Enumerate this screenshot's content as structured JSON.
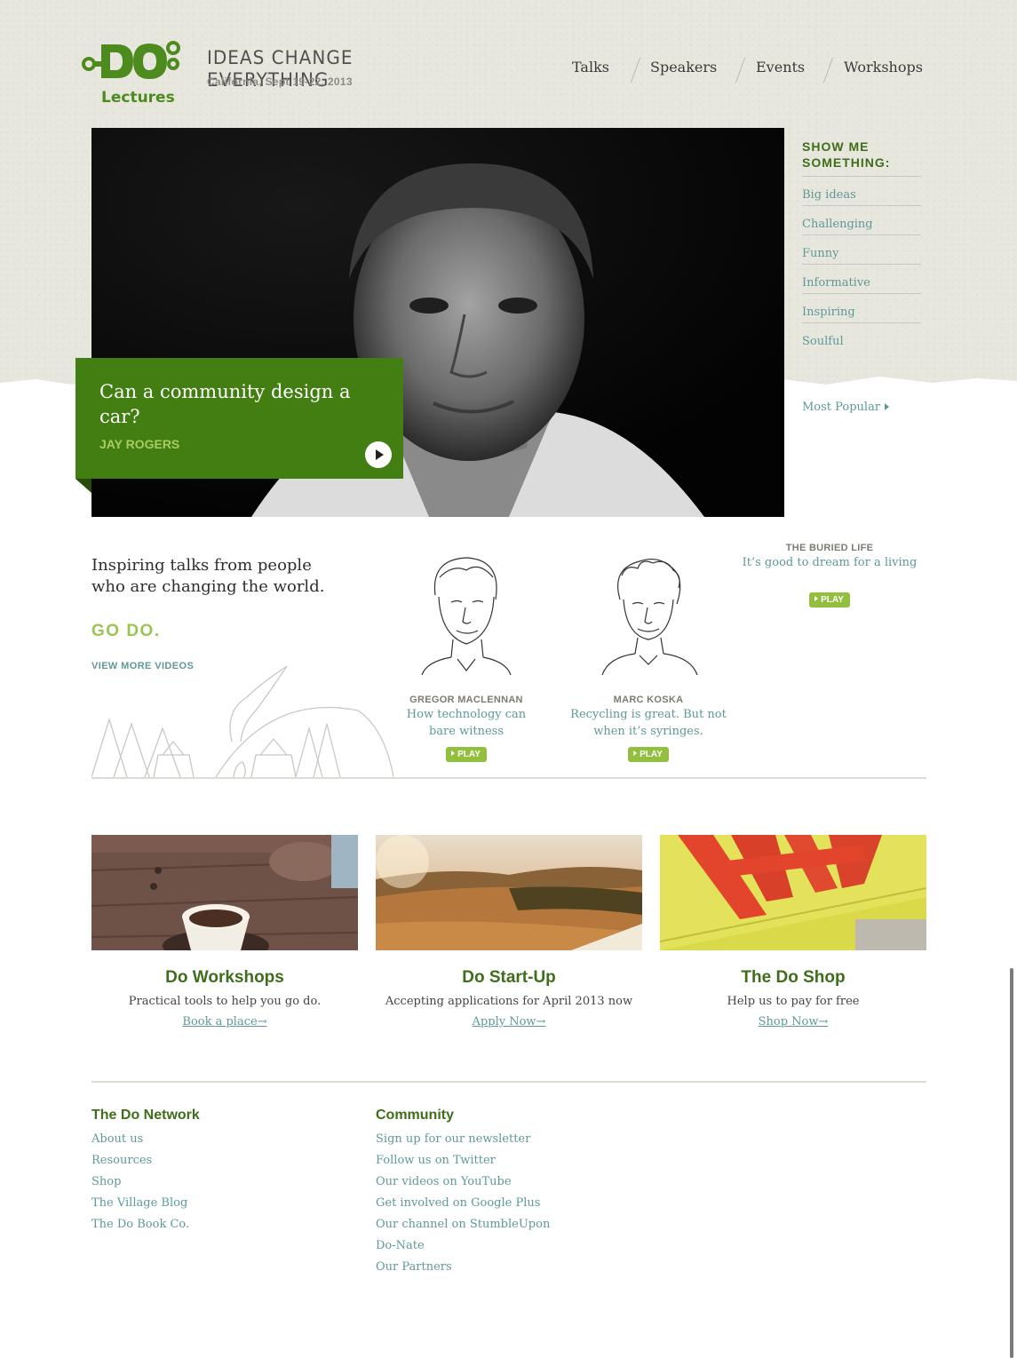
{
  "brand": {
    "logo_word": "DO",
    "logo_sub": "Lectures",
    "tagline": "IDEAS CHANGE EVERYTHING",
    "event_dates": "California, Sept 19-22, 2013",
    "green": "#437e13",
    "light_green": "#9bc552",
    "link_teal": "#5f9898"
  },
  "nav": {
    "items": [
      "Talks",
      "Speakers",
      "Events",
      "Workshops"
    ]
  },
  "feature": {
    "title": "Can a community design a car?",
    "speaker": "JAY ROGERS",
    "play_icon": "play-circle-icon"
  },
  "show_me": {
    "heading": "SHOW ME SOMETHING:",
    "items": [
      "Big ideas",
      "Challenging",
      "Funny",
      "Informative",
      "Inspiring",
      "Soulful"
    ],
    "most_popular": "Most Popular"
  },
  "intro": {
    "text": "Inspiring talks from people who are changing the world.",
    "go_do": "GO DO.",
    "view_more": "VIEW MORE VIDEOS"
  },
  "talks": [
    {
      "speaker": "GREGOR MACLENNAN",
      "title": "How technology can bare witness",
      "play": "PLAY"
    },
    {
      "speaker": "MARC KOSKA",
      "title": "Recycling is great. But not when it’s syringes.",
      "play": "PLAY"
    },
    {
      "speaker": "THE BURIED LIFE",
      "title": "It’s good to dream for a living",
      "play": "PLAY"
    }
  ],
  "promos": [
    {
      "title": "Do Workshops",
      "desc": "Practical tools to help you go do.",
      "link": "Book a place→"
    },
    {
      "title": "Do Start-Up",
      "desc": "Accepting applications for April 2013 now",
      "link": "Apply Now→"
    },
    {
      "title": "The Do Shop",
      "desc": "Help us to pay for free",
      "link": "Shop Now→"
    }
  ],
  "footer": {
    "network": {
      "heading": "The Do Network",
      "links": [
        "About us",
        "Resources",
        "Shop",
        "The Village Blog",
        "The Do Book Co."
      ]
    },
    "community": {
      "heading": "Community",
      "links": [
        "Sign up for our newsletter",
        "Follow us on Twitter",
        "Our videos on YouTube",
        "Get involved on Google Plus",
        "Our channel on StumbleUpon",
        "Do-Nate",
        "Our Partners"
      ]
    }
  }
}
